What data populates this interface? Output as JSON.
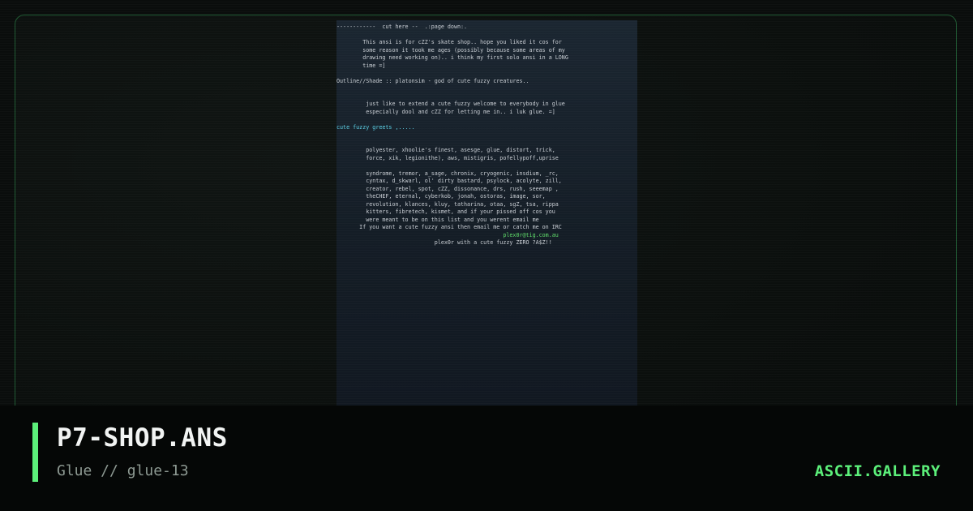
{
  "art": {
    "lines": [
      {
        "text": "------------  cut here --  .:page down:.",
        "color": "normal"
      },
      {
        "text": "",
        "color": "normal"
      },
      {
        "text": "        This ansi is for cZZ's skate shop.. hope you liked it cos for",
        "color": "normal"
      },
      {
        "text": "        some reason it took me ages (possibly because some areas of my",
        "color": "normal"
      },
      {
        "text": "        drawing need working on).. i think my first solo ansi in a LONG",
        "color": "normal"
      },
      {
        "text": "        time =]",
        "color": "normal"
      },
      {
        "text": "",
        "color": "normal"
      },
      {
        "text": "Outline//Shade :: platonsim - god of cute fuzzy creatures..",
        "color": "normal"
      },
      {
        "text": "",
        "color": "normal"
      },
      {
        "text": "",
        "color": "normal"
      },
      {
        "text": "         just like to extend a cute fuzzy welcome to everybody in glue",
        "color": "normal"
      },
      {
        "text": "         especially dool and cZZ for letting me in.. i luk glue. =]",
        "color": "normal"
      },
      {
        "text": "",
        "color": "normal"
      },
      {
        "text": "cute fuzzy greets ,.....",
        "color": "cyan"
      },
      {
        "text": "",
        "color": "normal"
      },
      {
        "text": "",
        "color": "normal"
      },
      {
        "text": "         polyester, xhoolie's finest, asesge, glue, distort, trick,",
        "color": "normal"
      },
      {
        "text": "         force, xik, legionithe), aws, mistigris, pofellypoff,uprise",
        "color": "normal"
      },
      {
        "text": "",
        "color": "normal"
      },
      {
        "text": "         syndrome, tremor, a_sage, chronix, cryogenic, insdium, _rc,",
        "color": "normal"
      },
      {
        "text": "         cyntax, d_skwarl, ol' dirty bastard, psylock, acolyte, zill,",
        "color": "normal"
      },
      {
        "text": "         creator, rebel, spot, cZZ, dissonance, drs, rush, seeemap ,",
        "color": "normal"
      },
      {
        "text": "         theCHEF, eternal, cyberkob, jonah, ostoras, image, sor,",
        "color": "normal"
      },
      {
        "text": "         revolution, klances, kluy, tatharina, otaa, sgZ, tsa, rippa",
        "color": "normal"
      },
      {
        "text": "         kitters, fibretech, kismet, and if your pissed off cos you",
        "color": "normal"
      },
      {
        "text": "         were meant to be on this list and you werent email me",
        "color": "normal"
      },
      {
        "text": "       If you want a cute fuzzy ansi then email me or catch me on IRC",
        "color": "normal"
      },
      {
        "text": "                                                   plex0r@tig.com.au",
        "color": "green"
      },
      {
        "text": "                              plex0r with a cute fuzzy ZERO ?A$Z!!",
        "color": "normal"
      }
    ]
  },
  "footer": {
    "title": "P7-SHOP.ANS",
    "subtitle": "Glue // glue-13",
    "brand": "ASCII.GALLERY"
  },
  "colors": {
    "accent": "#5cf07a",
    "frame_border": "#1f5a33",
    "art_text": "#c9ced4",
    "art_green": "#5fdc6a",
    "art_cyan": "#5ad0e6"
  }
}
